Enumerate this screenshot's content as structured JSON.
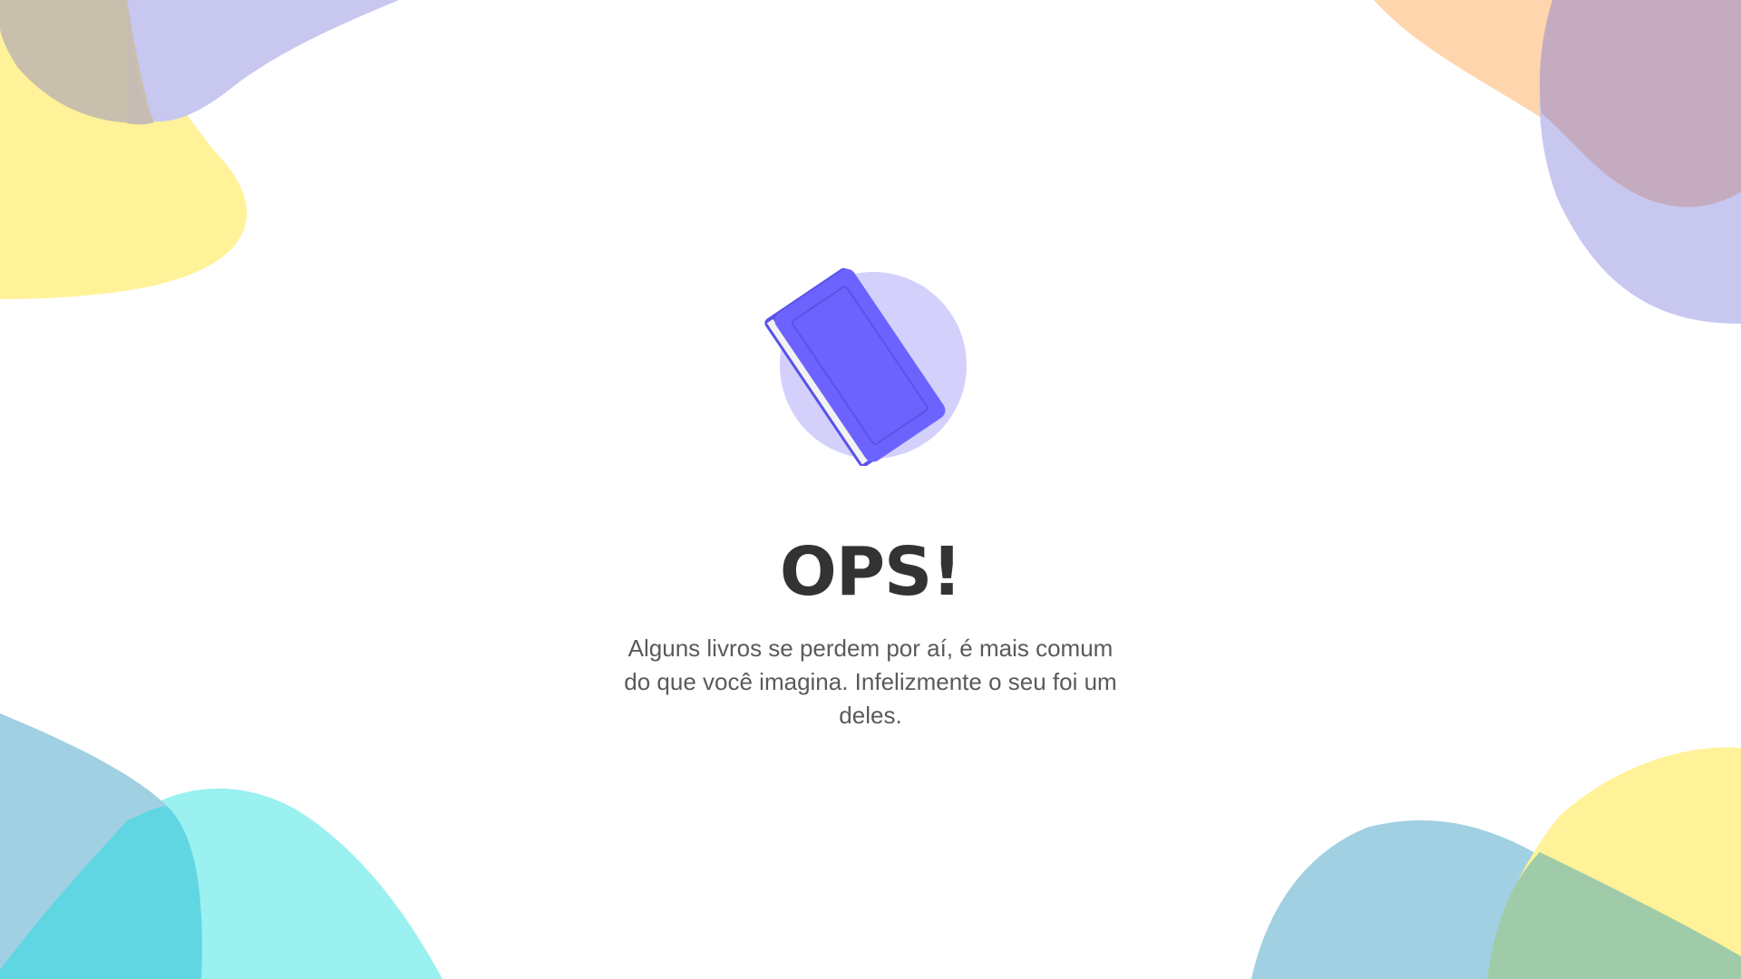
{
  "error": {
    "title": "OPS!",
    "message": "Alguns livros se perdem por aí, é mais comum do que você imagina. Infelizmente o seu foi um deles."
  },
  "illustration": {
    "icon": "book-icon",
    "book_color": "#6c63ff",
    "circle_color": "#d3d1fc"
  },
  "colors": {
    "title": "#333333",
    "message": "#5a5a5a",
    "blob_yellow": "#fff299",
    "blob_lavender": "#c8c7f0",
    "blob_peach": "#ffd5ad",
    "blob_blue": "#a0d0e2",
    "blob_cyan": "#9bf0f0"
  }
}
